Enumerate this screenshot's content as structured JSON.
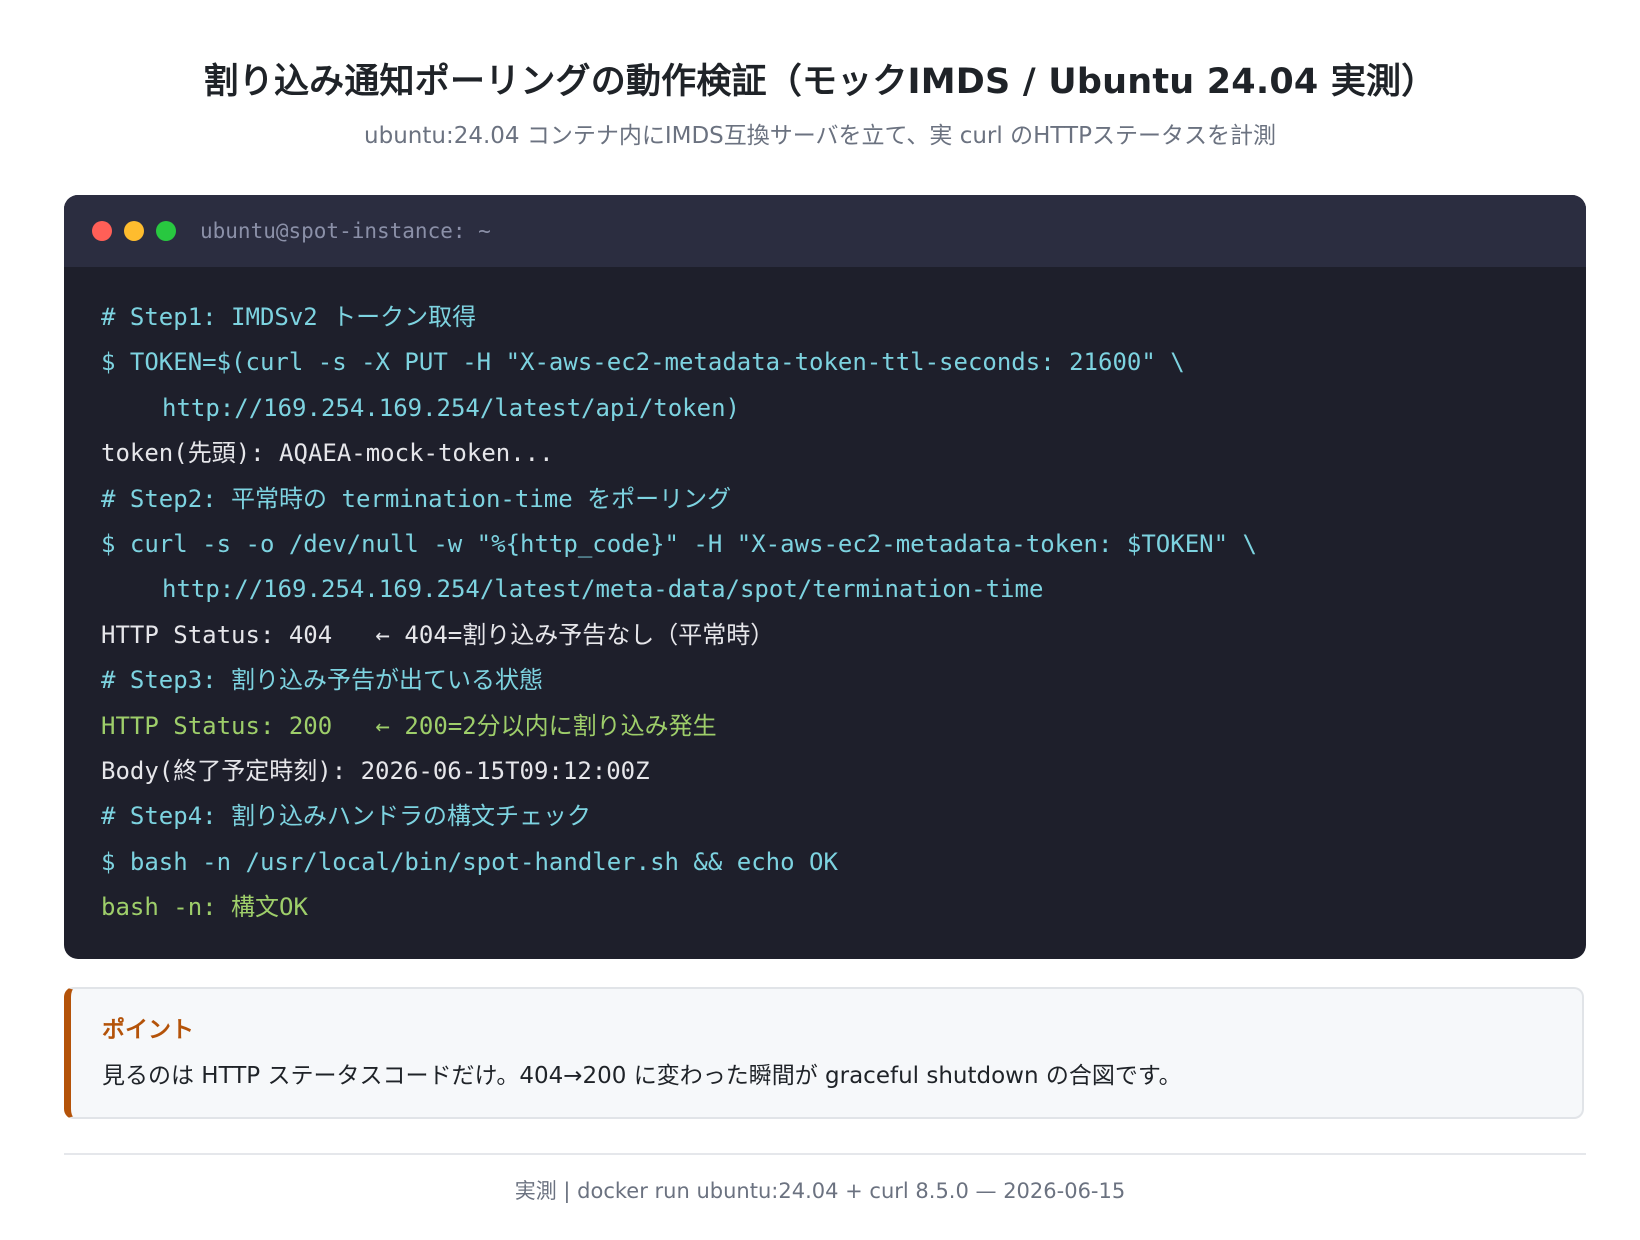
{
  "header": {
    "title": "割り込み通知ポーリングの動作検証（モックIMDS / Ubuntu 24.04 実測）",
    "subtitle": "ubuntu:24.04 コンテナ内にIMDS互換サーバを立て、実 curl のHTTPステータスを計測"
  },
  "terminal": {
    "title": "ubuntu@spot-instance: ~",
    "window_dots": [
      "close",
      "minimize",
      "maximize"
    ],
    "lines": [
      {
        "type": "comment",
        "text": "# Step1: IMDSv2 トークン取得"
      },
      {
        "type": "cmd",
        "text": "$ TOKEN=$(curl -s -X PUT -H \"X-aws-ec2-metadata-token-ttl-seconds: 21600\" \\"
      },
      {
        "type": "cmd",
        "indent": true,
        "text": "http://169.254.169.254/latest/api/token)"
      },
      {
        "type": "out",
        "text": "token(先頭): AQAEA-mock-token..."
      },
      {
        "type": "comment",
        "text": "# Step2: 平常時の termination-time をポーリング"
      },
      {
        "type": "cmd",
        "text": "$ curl -s -o /dev/null -w \"%{http_code}\" -H \"X-aws-ec2-metadata-token: $TOKEN\" \\"
      },
      {
        "type": "cmd",
        "indent": true,
        "text": "http://169.254.169.254/latest/meta-data/spot/termination-time"
      },
      {
        "type": "out",
        "text": "HTTP Status: 404   ← 404=割り込み予告なし（平常時）"
      },
      {
        "type": "comment",
        "text": "# Step3: 割り込み予告が出ている状態"
      },
      {
        "type": "ok",
        "text": "HTTP Status: 200   ← 200=2分以内に割り込み発生"
      },
      {
        "type": "out",
        "text": "Body(終了予定時刻): 2026-06-15T09:12:00Z"
      },
      {
        "type": "comment",
        "text": "# Step4: 割り込みハンドラの構文チェック"
      },
      {
        "type": "cmd",
        "text": "$ bash -n /usr/local/bin/spot-handler.sh && echo OK"
      },
      {
        "type": "ok",
        "text": "bash -n: 構文OK"
      }
    ]
  },
  "note": {
    "heading": "ポイント",
    "text": "見るのは HTTP ステータスコードだけ。404→200 に変わった瞬間が graceful shutdown の合図です。"
  },
  "footer": {
    "text": "実測 | docker run ubuntu:24.04 + curl 8.5.0 — 2026-06-15"
  },
  "colors": {
    "terminal_bg": "#1e1f2b",
    "terminal_bar": "#2b2d40",
    "command": "#7dd3e0",
    "output": "#e6e6ea",
    "success": "#9ece6a",
    "accent": "#b45309"
  }
}
